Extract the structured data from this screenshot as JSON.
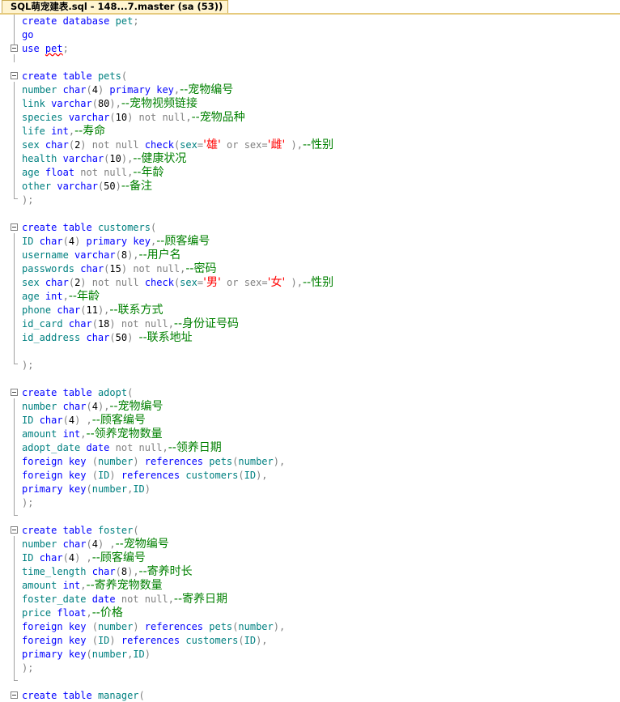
{
  "tab": {
    "title": "SQL萌宠建表.sql - 148...7.master (sa (53))"
  },
  "code": {
    "l1": "create database pet;",
    "l2": "go",
    "l3_kw": "use",
    "l3_db": "pet",
    "l3_end": ";",
    "pets": {
      "head": "create table pets(",
      "f1": "number char(4) primary key,",
      "f1c": "--宠物编号",
      "f2": "link varchar(80),",
      "f2c": "--宠物视频链接",
      "f3": "species varchar(10) not null,",
      "f3c": "--宠物品种",
      "f4": "life int,",
      "f4c": "--寿命",
      "f5a": "sex char(2) not null check(sex=",
      "f5v1": "'雄'",
      "f5b": " or sex=",
      "f5v2": "'雌'",
      "f5c": " ),",
      "f5cm": "--性别",
      "f6": "health varchar(10),",
      "f6c": "--健康状况",
      "f7": "age float not null,",
      "f7c": "--年龄",
      "f8": "other varchar(50)",
      "f8c": "--备注",
      "end": ");"
    },
    "customers": {
      "head": "create table customers(",
      "f1": "ID char(4) primary key,",
      "f1c": "--顾客编号",
      "f2": "username varchar(8),",
      "f2c": "--用户名",
      "f3": "passwords char(15) not null,",
      "f3c": "--密码",
      "f4a": "sex char(2) not null check(sex=",
      "f4v1": "'男'",
      "f4b": " or sex=",
      "f4v2": "'女'",
      "f4c": " ),",
      "f4cm": "--性别",
      "f5": "age int,",
      "f5c": "--年龄",
      "f6": "phone char(11),",
      "f6c": "--联系方式",
      "f7": "id_card char(18) not null,",
      "f7c": "--身份证号码",
      "f8": "id_address char(50) ",
      "f8c": "--联系地址",
      "end": ");"
    },
    "adopt": {
      "head": "create table adopt(",
      "f1": "number char(4),",
      "f1c": "--宠物编号",
      "f2": "ID char(4) ,",
      "f2c": "--顾客编号",
      "f3": "amount int,",
      "f3c": "--领养宠物数量",
      "f4": "adopt_date date not null,",
      "f4c": "--领养日期",
      "f5": "foreign key (number) references pets(number),",
      "f6": "foreign key (ID) references customers(ID),",
      "f7": "primary key(number,ID)",
      "end": ");"
    },
    "foster": {
      "head": "create table foster(",
      "f1": "number char(4) ,",
      "f1c": "--宠物编号",
      "f2": "ID char(4) ,",
      "f2c": "--顾客编号",
      "f3": "time_length char(8),",
      "f3c": "--寄养时长",
      "f4": "amount int,",
      "f4c": "--寄养宠物数量",
      "f5": "foster_date date not null,",
      "f5c": "--寄养日期",
      "f6": "price float,",
      "f6c": "--价格",
      "f7": "foreign key (number) references pets(number),",
      "f8": "foreign key (ID) references customers(ID),",
      "f9": "primary key(number,ID)",
      "end": ");"
    },
    "manager": {
      "head": "create table manager("
    }
  }
}
